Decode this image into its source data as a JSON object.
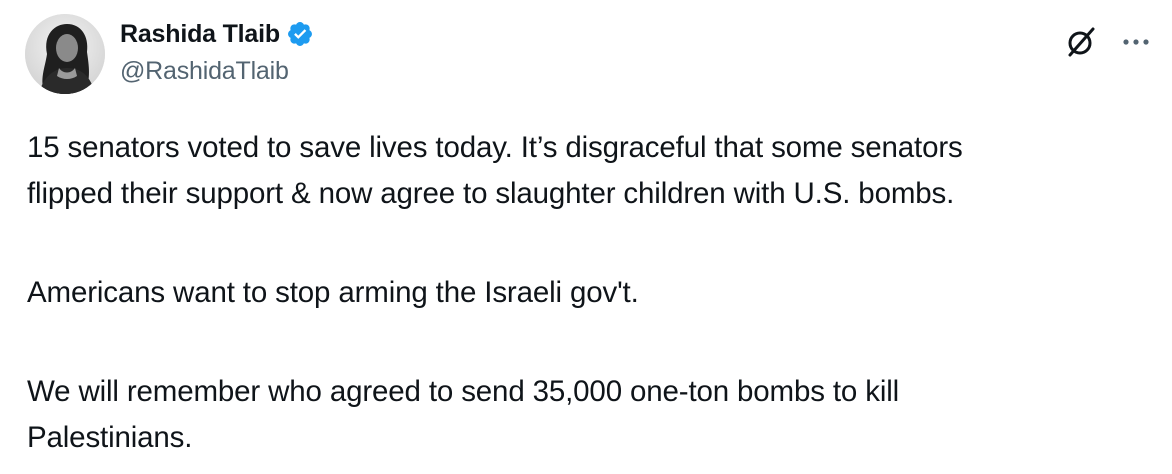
{
  "author": {
    "display_name": "Rashida Tlaib",
    "handle": "@RashidaTlaib",
    "verified": true,
    "verified_color": "#1d9bf0"
  },
  "icons": {
    "verified": "verified-badge-icon",
    "grok": "grok-icon",
    "more": "more-options-icon"
  },
  "tweet": {
    "line_1": "15 senators voted to save lives today. It’s disgraceful that some senators",
    "line_2": "flipped their support & now agree to slaughter children with U.S. bombs.",
    "paragraph_2": "Americans want to stop arming the Israeli gov't.",
    "line_3a": "We will remember who agreed to send 35,000 one-ton bombs to kill",
    "line_3b": "Palestinians."
  },
  "colors": {
    "text": "#0f1419",
    "secondary_text": "#536471"
  }
}
